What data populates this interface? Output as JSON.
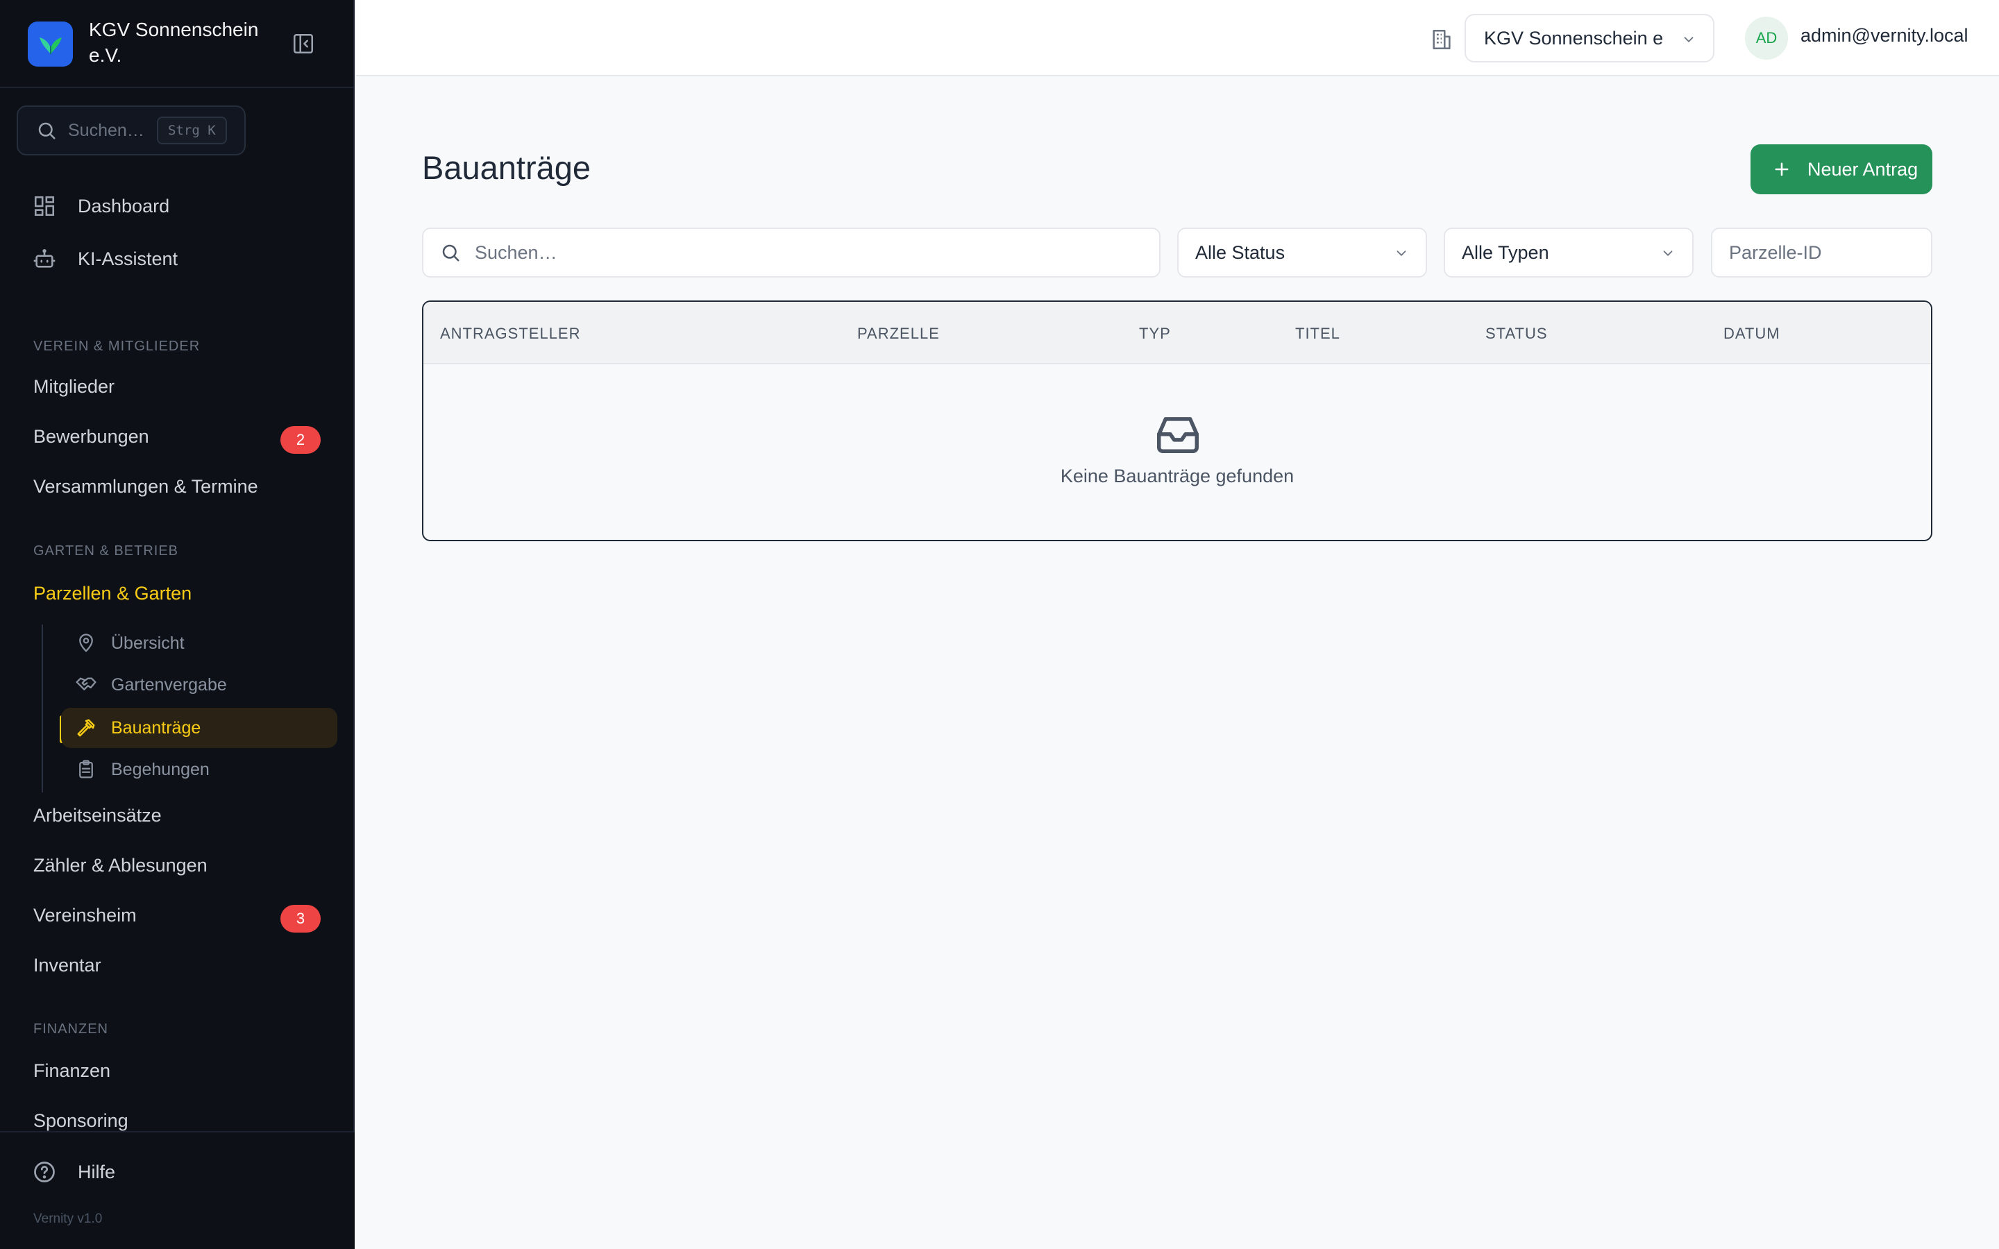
{
  "brand": {
    "name": "KGV Sonnenschein e.V.",
    "logo_color": "#2563eb"
  },
  "sidebar": {
    "search": {
      "placeholder": "Suchen…",
      "shortcut": "Strg K"
    },
    "top_items": [
      {
        "label": "Dashboard",
        "icon": "dashboard-icon"
      },
      {
        "label": "KI-Assistent",
        "icon": "robot-icon"
      }
    ],
    "sections": [
      {
        "heading": "VEREIN & MITGLIEDER",
        "items": [
          {
            "label": "Mitglieder"
          },
          {
            "label": "Bewerbungen",
            "badge": "2"
          },
          {
            "label": "Versammlungen & Termine"
          }
        ]
      },
      {
        "heading": "GARTEN & BETRIEB",
        "items": [
          {
            "label": "Parzellen & Garten",
            "expanded": true,
            "children": [
              {
                "label": "Übersicht",
                "icon": "map-pin-icon"
              },
              {
                "label": "Gartenvergabe",
                "icon": "handshake-icon"
              },
              {
                "label": "Bauanträge",
                "icon": "hammer-icon",
                "active": true
              },
              {
                "label": "Begehungen",
                "icon": "clipboard-icon"
              }
            ]
          },
          {
            "label": "Arbeitseinsätze"
          },
          {
            "label": "Zähler & Ablesungen"
          },
          {
            "label": "Vereinsheim",
            "badge": "3"
          },
          {
            "label": "Inventar"
          }
        ]
      },
      {
        "heading": "FINANZEN",
        "items": [
          {
            "label": "Finanzen"
          },
          {
            "label": "Sponsoring"
          }
        ]
      }
    ],
    "help": {
      "label": "Hilfe",
      "icon": "help-circle-icon"
    },
    "version": "Vernity v1.0"
  },
  "topbar": {
    "org_select": "KGV Sonnenschein e.V.",
    "avatar_initials": "AD",
    "user_email": "admin@vernity.local"
  },
  "main": {
    "title": "Bauanträge",
    "new_button": "Neuer Antrag",
    "filters": {
      "search_placeholder": "Suchen…",
      "status_select": "Alle Status",
      "type_select": "Alle Typen",
      "parcel_placeholder": "Parzelle-ID"
    },
    "table": {
      "columns": [
        "ANTRAGSTELLER",
        "PARZELLE",
        "TYP",
        "TITEL",
        "STATUS",
        "DATUM"
      ],
      "rows": [],
      "empty_text": "Keine Bauanträge gefunden",
      "empty_icon": "inbox-icon"
    }
  },
  "colors": {
    "sidebar_bg": "#0d1117",
    "accent_yellow": "#facc15",
    "primary_green": "#259259",
    "badge_red": "#ef4444"
  }
}
